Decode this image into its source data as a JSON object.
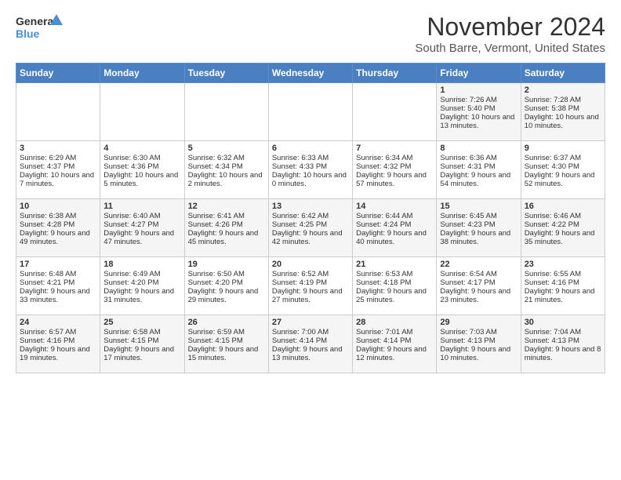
{
  "header": {
    "logo_line1": "General",
    "logo_line2": "Blue",
    "month": "November 2024",
    "location": "South Barre, Vermont, United States"
  },
  "days_of_week": [
    "Sunday",
    "Monday",
    "Tuesday",
    "Wednesday",
    "Thursday",
    "Friday",
    "Saturday"
  ],
  "weeks": [
    [
      {
        "day": "",
        "info": ""
      },
      {
        "day": "",
        "info": ""
      },
      {
        "day": "",
        "info": ""
      },
      {
        "day": "",
        "info": ""
      },
      {
        "day": "",
        "info": ""
      },
      {
        "day": "1",
        "info": "Sunrise: 7:26 AM\nSunset: 5:40 PM\nDaylight: 10 hours and 13 minutes."
      },
      {
        "day": "2",
        "info": "Sunrise: 7:28 AM\nSunset: 5:38 PM\nDaylight: 10 hours and 10 minutes."
      }
    ],
    [
      {
        "day": "3",
        "info": "Sunrise: 6:29 AM\nSunset: 4:37 PM\nDaylight: 10 hours and 7 minutes."
      },
      {
        "day": "4",
        "info": "Sunrise: 6:30 AM\nSunset: 4:36 PM\nDaylight: 10 hours and 5 minutes."
      },
      {
        "day": "5",
        "info": "Sunrise: 6:32 AM\nSunset: 4:34 PM\nDaylight: 10 hours and 2 minutes."
      },
      {
        "day": "6",
        "info": "Sunrise: 6:33 AM\nSunset: 4:33 PM\nDaylight: 10 hours and 0 minutes."
      },
      {
        "day": "7",
        "info": "Sunrise: 6:34 AM\nSunset: 4:32 PM\nDaylight: 9 hours and 57 minutes."
      },
      {
        "day": "8",
        "info": "Sunrise: 6:36 AM\nSunset: 4:31 PM\nDaylight: 9 hours and 54 minutes."
      },
      {
        "day": "9",
        "info": "Sunrise: 6:37 AM\nSunset: 4:30 PM\nDaylight: 9 hours and 52 minutes."
      }
    ],
    [
      {
        "day": "10",
        "info": "Sunrise: 6:38 AM\nSunset: 4:28 PM\nDaylight: 9 hours and 49 minutes."
      },
      {
        "day": "11",
        "info": "Sunrise: 6:40 AM\nSunset: 4:27 PM\nDaylight: 9 hours and 47 minutes."
      },
      {
        "day": "12",
        "info": "Sunrise: 6:41 AM\nSunset: 4:26 PM\nDaylight: 9 hours and 45 minutes."
      },
      {
        "day": "13",
        "info": "Sunrise: 6:42 AM\nSunset: 4:25 PM\nDaylight: 9 hours and 42 minutes."
      },
      {
        "day": "14",
        "info": "Sunrise: 6:44 AM\nSunset: 4:24 PM\nDaylight: 9 hours and 40 minutes."
      },
      {
        "day": "15",
        "info": "Sunrise: 6:45 AM\nSunset: 4:23 PM\nDaylight: 9 hours and 38 minutes."
      },
      {
        "day": "16",
        "info": "Sunrise: 6:46 AM\nSunset: 4:22 PM\nDaylight: 9 hours and 35 minutes."
      }
    ],
    [
      {
        "day": "17",
        "info": "Sunrise: 6:48 AM\nSunset: 4:21 PM\nDaylight: 9 hours and 33 minutes."
      },
      {
        "day": "18",
        "info": "Sunrise: 6:49 AM\nSunset: 4:20 PM\nDaylight: 9 hours and 31 minutes."
      },
      {
        "day": "19",
        "info": "Sunrise: 6:50 AM\nSunset: 4:20 PM\nDaylight: 9 hours and 29 minutes."
      },
      {
        "day": "20",
        "info": "Sunrise: 6:52 AM\nSunset: 4:19 PM\nDaylight: 9 hours and 27 minutes."
      },
      {
        "day": "21",
        "info": "Sunrise: 6:53 AM\nSunset: 4:18 PM\nDaylight: 9 hours and 25 minutes."
      },
      {
        "day": "22",
        "info": "Sunrise: 6:54 AM\nSunset: 4:17 PM\nDaylight: 9 hours and 23 minutes."
      },
      {
        "day": "23",
        "info": "Sunrise: 6:55 AM\nSunset: 4:16 PM\nDaylight: 9 hours and 21 minutes."
      }
    ],
    [
      {
        "day": "24",
        "info": "Sunrise: 6:57 AM\nSunset: 4:16 PM\nDaylight: 9 hours and 19 minutes."
      },
      {
        "day": "25",
        "info": "Sunrise: 6:58 AM\nSunset: 4:15 PM\nDaylight: 9 hours and 17 minutes."
      },
      {
        "day": "26",
        "info": "Sunrise: 6:59 AM\nSunset: 4:15 PM\nDaylight: 9 hours and 15 minutes."
      },
      {
        "day": "27",
        "info": "Sunrise: 7:00 AM\nSunset: 4:14 PM\nDaylight: 9 hours and 13 minutes."
      },
      {
        "day": "28",
        "info": "Sunrise: 7:01 AM\nSunset: 4:14 PM\nDaylight: 9 hours and 12 minutes."
      },
      {
        "day": "29",
        "info": "Sunrise: 7:03 AM\nSunset: 4:13 PM\nDaylight: 9 hours and 10 minutes."
      },
      {
        "day": "30",
        "info": "Sunrise: 7:04 AM\nSunset: 4:13 PM\nDaylight: 9 hours and 8 minutes."
      }
    ]
  ]
}
